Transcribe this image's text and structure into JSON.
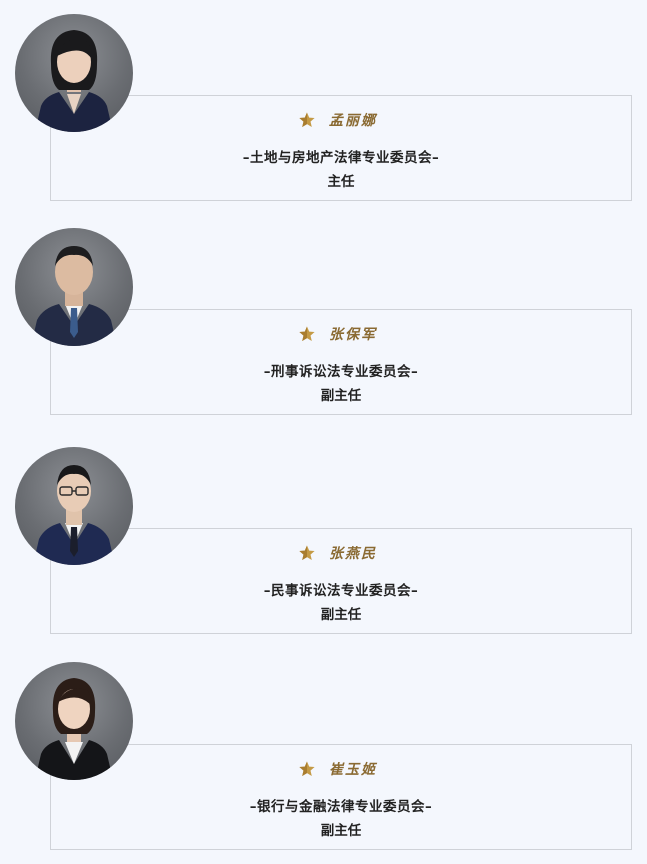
{
  "colors": {
    "background": "#f4f7fd",
    "name_gold": "#8a6a32",
    "card_border": "#cfd2d8",
    "text": "#222222"
  },
  "members": [
    {
      "name": "孟丽娜",
      "committee": "–土地与房地产法律专业委员会–",
      "position": "主任",
      "photo_icon": "female-portrait-icon"
    },
    {
      "name": "张保军",
      "committee": "–刑事诉讼法专业委员会–",
      "position": "副主任",
      "photo_icon": "male-portrait-icon"
    },
    {
      "name": "张燕民",
      "committee": "–民事诉讼法专业委员会–",
      "position": "副主任",
      "photo_icon": "male-portrait-glasses-icon"
    },
    {
      "name": "崔玉姬",
      "committee": "–银行与金融法律专业委员会–",
      "position": "副主任",
      "photo_icon": "female-portrait-icon"
    }
  ]
}
